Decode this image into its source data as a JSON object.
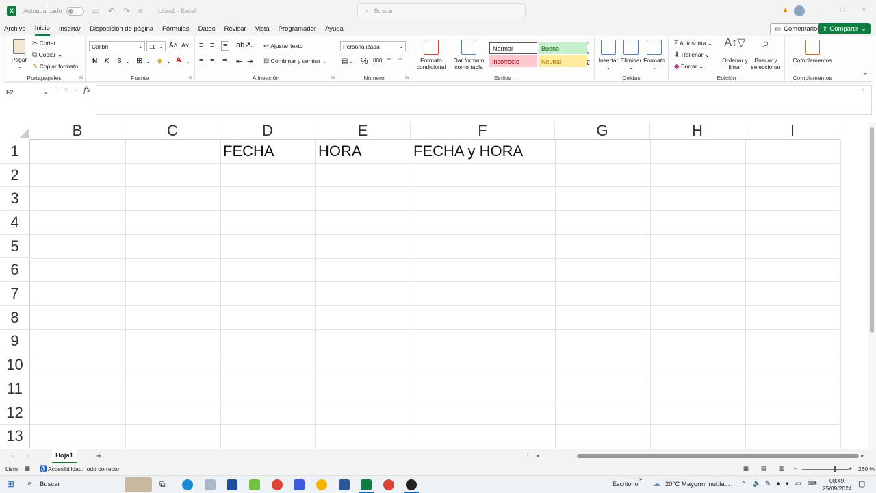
{
  "titlebar": {
    "autosave_label": "Autoguardado",
    "doc_title": "Libro1 - Excel",
    "search_placeholder": "Buscar"
  },
  "menu": {
    "tabs": [
      "Archivo",
      "Inicio",
      "Insertar",
      "Disposición de página",
      "Fórmulas",
      "Datos",
      "Revisar",
      "Vista",
      "Programador",
      "Ayuda"
    ],
    "active_tab": "Inicio",
    "comments_label": "Comentarios",
    "share_label": "Compartir"
  },
  "ribbon": {
    "clipboard": {
      "paste": "Pegar",
      "cut": "Cortar",
      "copy": "Copiar",
      "format_painter": "Copiar formato",
      "label": "Portapapeles"
    },
    "font": {
      "name": "Calibri",
      "size": "11",
      "bold": "N",
      "italic": "K",
      "underline": "S",
      "label": "Fuente"
    },
    "alignment": {
      "wrap": "Ajustar texto",
      "merge": "Combinar y centrar",
      "label": "Alineación"
    },
    "number": {
      "format": "Personalizada",
      "label": "Número"
    },
    "styles": {
      "conditional": "Formato condicional",
      "as_table": "Dar formato como tabla",
      "normal": "Normal",
      "good": "Bueno",
      "bad": "Incorrecto",
      "neutral": "Neutral",
      "label": "Estilos"
    },
    "cells": {
      "insert": "Insertar",
      "delete": "Eliminar",
      "format": "Formato",
      "label": "Celdas"
    },
    "editing": {
      "autosum": "Autosuma",
      "fill": "Rellenar",
      "clear": "Borrar",
      "sort": "Ordenar y filtrar",
      "find": "Buscar y seleccionar",
      "label": "Edición"
    },
    "addins": {
      "addins": "Complementos",
      "label": "Complementos"
    }
  },
  "formula_bar": {
    "name_box": "F2",
    "fx": "fx",
    "formula": ""
  },
  "grid": {
    "columns": [
      "B",
      "C",
      "D",
      "E",
      "F",
      "G",
      "H",
      "I"
    ],
    "rows": [
      "1",
      "2",
      "3",
      "4",
      "5",
      "6",
      "7",
      "8",
      "9",
      "10",
      "11",
      "12",
      "13"
    ],
    "cells": {
      "D1": "FECHA",
      "E1": "HORA",
      "F1": "FECHA y HORA"
    }
  },
  "sheets": {
    "tabs": [
      "Hoja1"
    ],
    "add": "+"
  },
  "statusbar": {
    "ready": "Listo",
    "accessibility": "Accesibilidad: todo correcto",
    "zoom": "260 %"
  },
  "taskbar": {
    "search": "Buscar",
    "desktop": "Escritorio",
    "weather": "20°C  Mayorm. nubla...",
    "time": "08:49",
    "date": "25/09/2024"
  },
  "colors": {
    "accent": "#107c41",
    "good_bg": "#c6efce",
    "bad_bg": "#ffc7ce",
    "neutral_bg": "#ffeb9c"
  }
}
